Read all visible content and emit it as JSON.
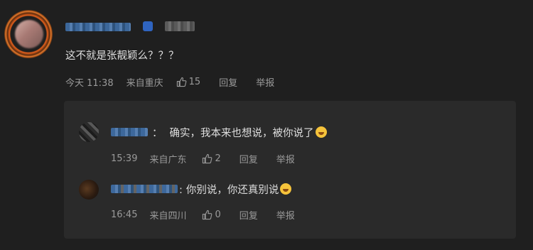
{
  "comment": {
    "text": "这不就是张靓颖么？？？",
    "time": "今天 11:38",
    "location": "来自重庆",
    "likes": "15",
    "reply_label": "回复",
    "report_label": "举报"
  },
  "replies": [
    {
      "separator": "：",
      "text": "确实，我本来也想说，被你说了",
      "time": "15:39",
      "location": "来自广东",
      "likes": "2",
      "reply_label": "回复",
      "report_label": "举报"
    },
    {
      "separator": ":",
      "text": "你别说，你还真别说",
      "time": "16:45",
      "location": "来自四川",
      "likes": "0",
      "reply_label": "回复",
      "report_label": "举报"
    }
  ],
  "colors": {
    "background": "#1f1f1f",
    "reply_box": "#2a2a2a",
    "username_blur": "#3f6fa8",
    "ring": "#e8621c"
  }
}
